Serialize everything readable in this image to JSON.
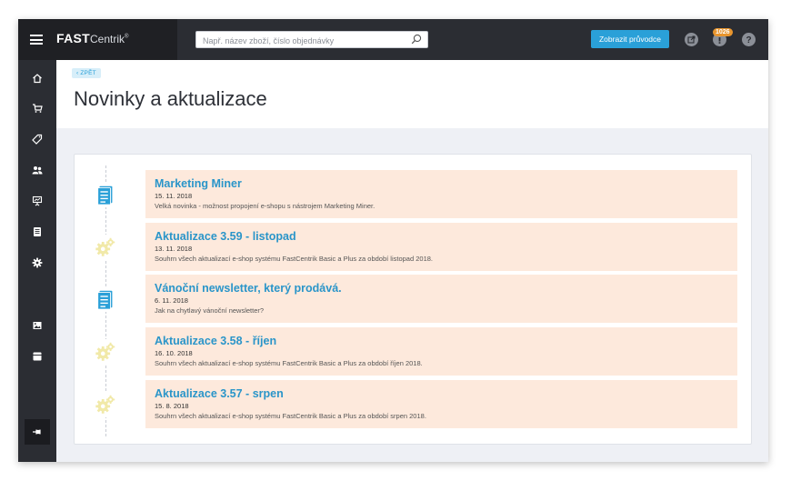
{
  "topbar": {
    "logo_fast": "FAST",
    "logo_centrik": "Centrik",
    "logo_reg": "®",
    "search_placeholder": "Např. název zboží, číslo objednávky",
    "guide_button": "Zobrazit průvodce",
    "notifications_badge": "1026",
    "icons": [
      "external-link-icon",
      "notification-icon",
      "help-icon"
    ]
  },
  "sidebar": {
    "items": [
      "home-icon",
      "cart-icon",
      "tag-icon",
      "customers-icon",
      "presentation-icon",
      "document-icon",
      "settings-icon",
      "image-icon",
      "archive-icon",
      "pin-icon"
    ]
  },
  "header": {
    "back_label": "‹ ZPĚT",
    "title": "Novinky a aktualizace"
  },
  "news": [
    {
      "icon": "document-icon",
      "title": "Marketing Miner",
      "date": "15. 11. 2018",
      "desc": "Velká novinka - možnost propojení e-shopu s nástrojem Marketing Miner."
    },
    {
      "icon": "gears-icon",
      "title": "Aktualizace 3.59 - listopad",
      "date": "13. 11. 2018",
      "desc": "Souhrn všech aktualizací e-shop systému FastCentrik Basic a Plus za období listopad 2018."
    },
    {
      "icon": "document-icon",
      "title": "Vánoční newsletter, který prodává.",
      "date": "6. 11. 2018",
      "desc": "Jak na chytlavý vánoční newsletter?"
    },
    {
      "icon": "gears-icon",
      "title": "Aktualizace 3.58 - říjen",
      "date": "16. 10. 2018",
      "desc": "Souhrn všech aktualizací e-shop systému FastCentrik Basic a Plus za období říjen 2018."
    },
    {
      "icon": "gears-icon",
      "title": "Aktualizace 3.57 - srpen",
      "date": "15. 8. 2018",
      "desc": "Souhrn všech aktualizací e-shop systému FastCentrik Basic a Plus za období srpen 2018."
    }
  ],
  "colors": {
    "accent": "#2aa0d8",
    "item_bg": "#fde9dc",
    "doc_icon": "#2aa0d8",
    "gear_icon": "#f1e9a8"
  }
}
